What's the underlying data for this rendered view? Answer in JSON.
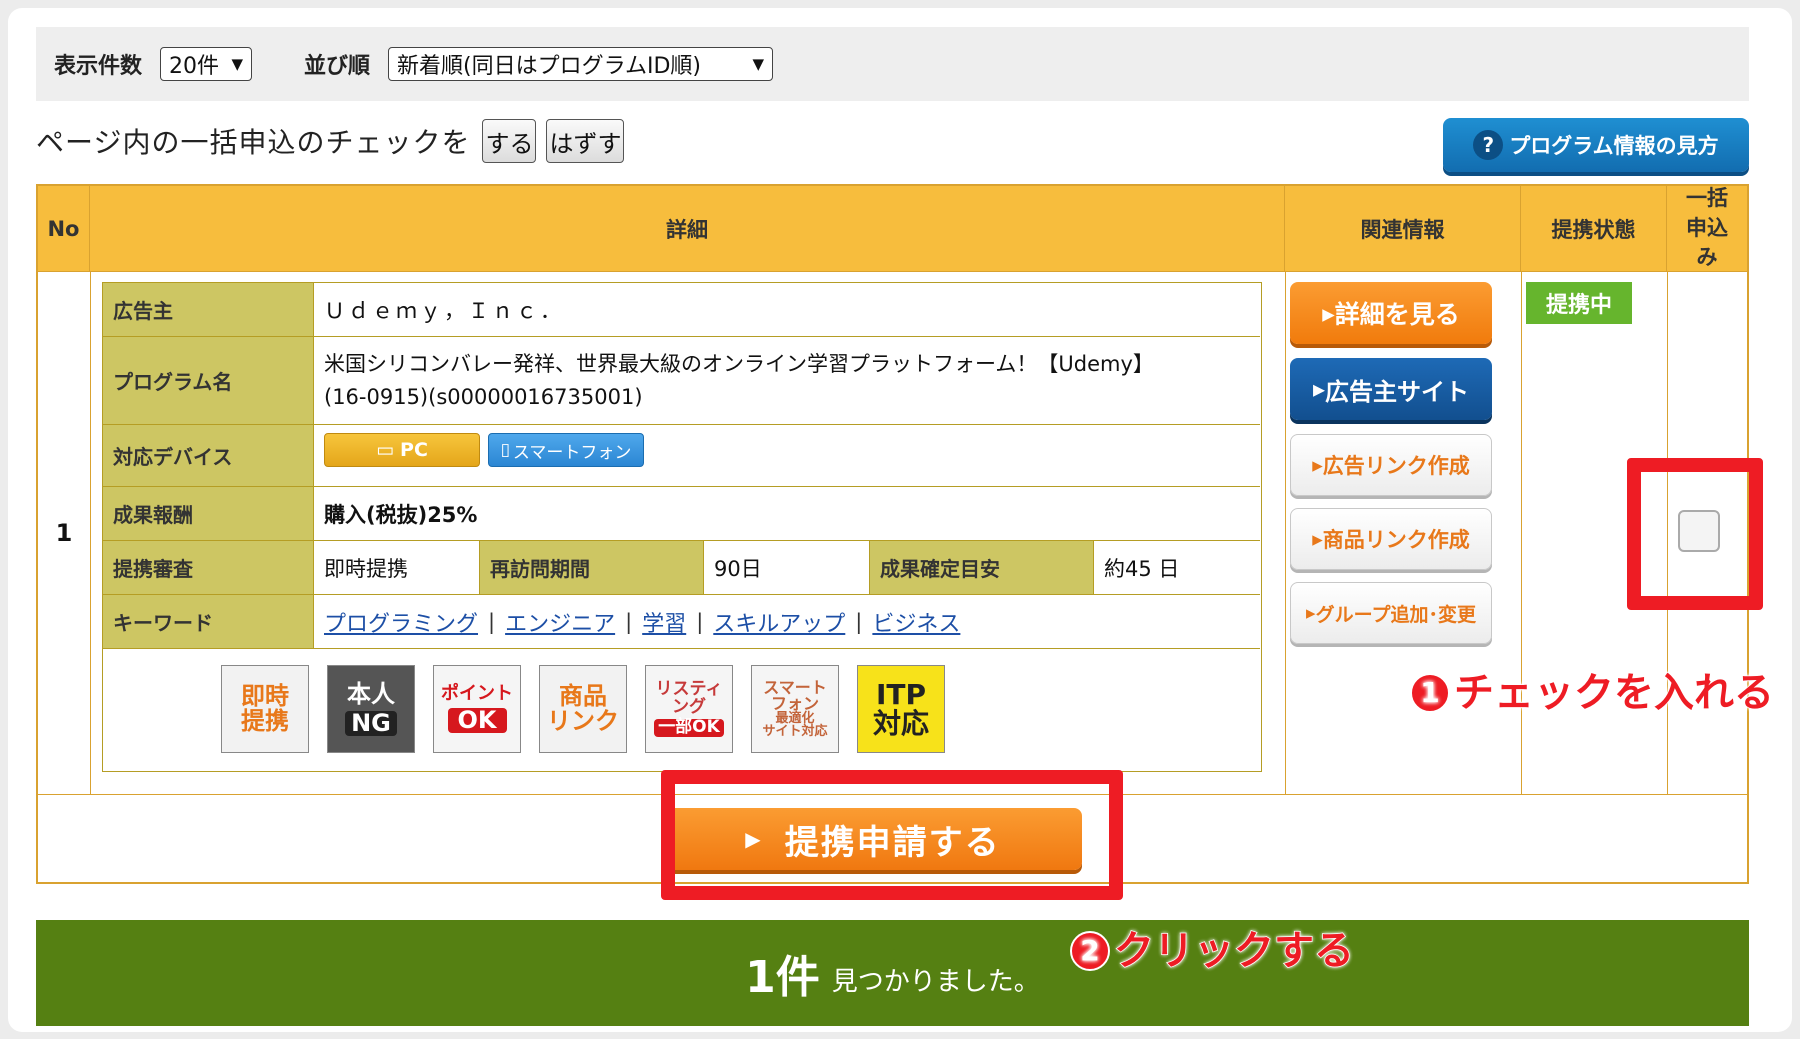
{
  "filter": {
    "count_label": "表示件数",
    "count_value": "20件",
    "sort_label": "並び順",
    "sort_value": "新着順(同日はプログラムID順)"
  },
  "bulk": {
    "label": "ページ内の一括申込のチェックを",
    "check_btn": "する",
    "uncheck_btn": "はずす",
    "help_btn": "プログラム情報の見方"
  },
  "table": {
    "headers": {
      "no": "No",
      "detail": "詳細",
      "related": "関連情報",
      "status": "提携状態",
      "bulk": "一括申込み"
    },
    "rows": [
      {
        "no": "1",
        "advertiser_label": "広告主",
        "advertiser": "Ｕｄｅｍｙ，Ｉｎｃ．",
        "program_label": "プログラム名",
        "program_line1": "米国シリコンバレー発祥、世界最大級のオンライン学習プラットフォーム！【Udemy】",
        "program_line2": "(16-0915)(s00000016735001)",
        "device_label": "対応デバイス",
        "device_pc": "PC",
        "device_sp": "スマートフォン",
        "reward_label": "成果報酬",
        "reward": "購入(税抜)25%",
        "review_label": "提携審査",
        "review": "即時提携",
        "revisit_label": "再訪問期間",
        "revisit": "90日",
        "confirm_label": "成果確定目安",
        "confirm": "約45 日",
        "keyword_label": "キーワード",
        "keywords": [
          "プログラミング",
          "エンジニア",
          "学習",
          "スキルアップ",
          "ビジネス"
        ],
        "badges": {
          "b1": [
            "即時",
            "提携"
          ],
          "b2": [
            "本人",
            "NG"
          ],
          "b3": [
            "ポイント",
            "OK"
          ],
          "b4": [
            "商品",
            "リンク"
          ],
          "b5": [
            "リスティ",
            "ング",
            "一部OK"
          ],
          "b6": [
            "スマート",
            "フォン",
            "最適化",
            "サイト対応"
          ],
          "b7": [
            "ITP",
            "対応"
          ]
        },
        "related_buttons": [
          "詳細を見る",
          "広告主サイト",
          "広告リンク作成",
          "商品リンク作成",
          "グループ追加･変更"
        ],
        "status": "提携中"
      }
    ]
  },
  "apply_button": "提携申請する",
  "annotations": {
    "a1_num": "1",
    "a1_text": "チェックを入れる",
    "a2_num": "2",
    "a2_text": "クリックする"
  },
  "result": {
    "count": "1件",
    "message": "見つかりました。"
  },
  "colors": {
    "header": "#f7bd3d",
    "label_bg": "#cdc663",
    "result_bg": "#558012",
    "annotation": "#ee1c24"
  }
}
